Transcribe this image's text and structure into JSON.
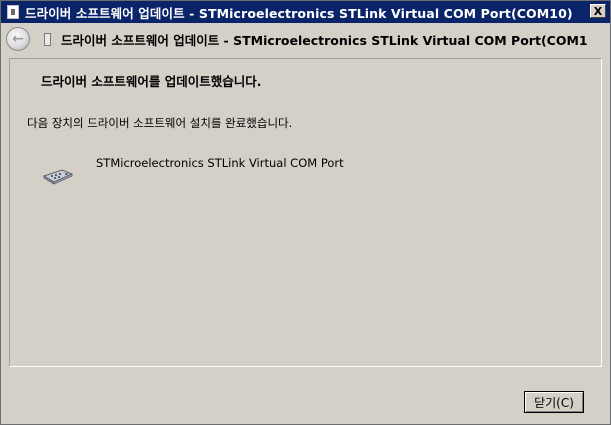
{
  "window": {
    "title": "드라이버 소프트웨어 업데이트 - STMicroelectronics STLink Virtual COM Port(COM10)",
    "close_glyph": "X",
    "icon": "driver-icon"
  },
  "header": {
    "back_glyph": "←",
    "title": "드라이버 소프트웨어 업데이트 - STMicroelectronics STLink Virtual COM Port(COM1",
    "icon": "driver-icon"
  },
  "content": {
    "heading": "드라이버 소프트웨어를 업데이트했습니다.",
    "message": "다음 장치의 드라이버 소프트웨어 설치를 완료했습니다.",
    "device": {
      "name": "STMicroelectronics STLink Virtual COM Port",
      "icon": "serial-port-icon"
    }
  },
  "footer": {
    "close_label": "닫기(C)"
  },
  "colors": {
    "titlebar": "#0a246a",
    "background": "#d4d0c8"
  }
}
